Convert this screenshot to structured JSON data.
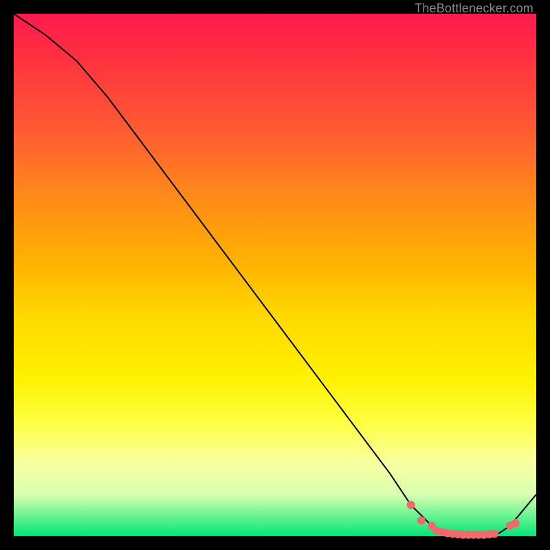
{
  "attribution": "TheBottlenecker.com",
  "chart_data": {
    "type": "line",
    "title": "",
    "xlabel": "",
    "ylabel": "",
    "xlim": [
      0,
      100
    ],
    "ylim": [
      0,
      100
    ],
    "series": [
      {
        "name": "bottleneck-curve",
        "x": [
          0,
          6,
          12,
          18,
          24,
          30,
          36,
          42,
          48,
          54,
          60,
          66,
          72,
          76,
          80,
          83,
          86,
          89,
          92,
          95,
          100
        ],
        "y": [
          100,
          96,
          91,
          84,
          76,
          68,
          60,
          52,
          44,
          36,
          28,
          20,
          12,
          6,
          2,
          0,
          0,
          0,
          0,
          2,
          8
        ]
      }
    ],
    "markers": {
      "name": "highlight-points",
      "x": [
        76,
        78,
        80,
        81,
        82,
        83,
        84,
        85,
        86,
        87,
        88,
        89,
        90,
        91,
        92,
        95,
        96
      ],
      "y": [
        6,
        3,
        2,
        1,
        0.8,
        0.6,
        0.5,
        0.4,
        0.3,
        0.3,
        0.3,
        0.3,
        0.3,
        0.4,
        0.5,
        2,
        2.5
      ]
    },
    "colors": {
      "line": "#000000",
      "marker": "#ef6b6b",
      "gradient_top": "#ff1a4d",
      "gradient_bottom": "#00e676"
    }
  }
}
